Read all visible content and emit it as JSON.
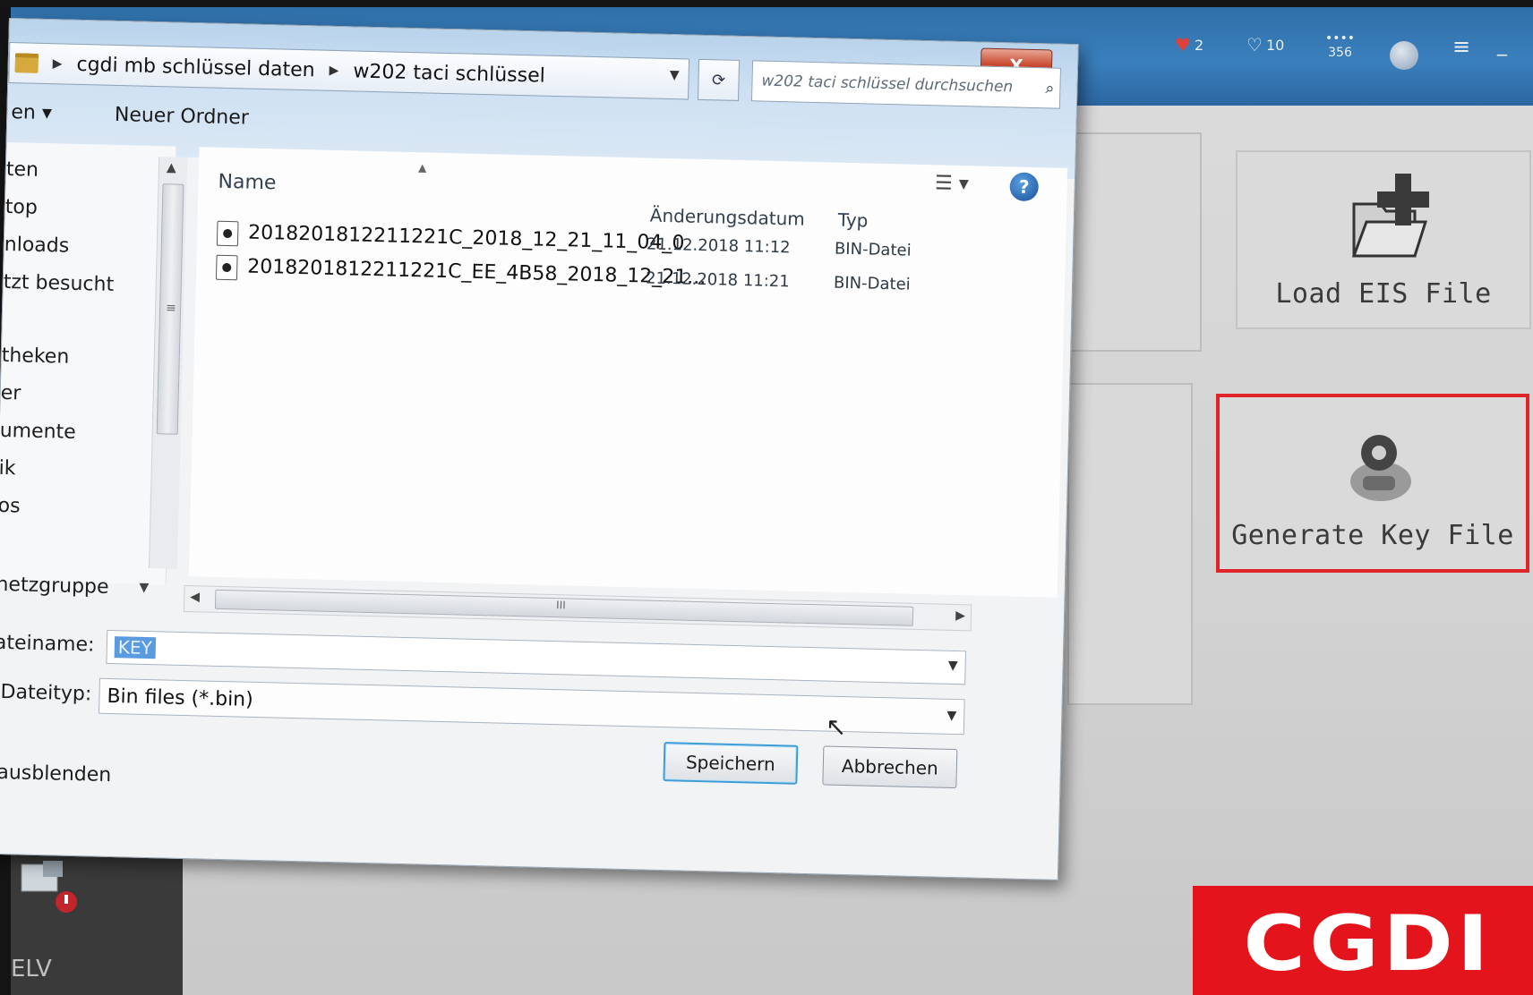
{
  "app": {
    "titlebar": {
      "heart_count": "2",
      "like_count": "10",
      "stat_top": "••••",
      "stat_value": "356",
      "menu_icon": "hamburger-icon",
      "minimize_icon": "minimize-icon"
    },
    "cards": {
      "load_eis": {
        "label": "Load EIS File",
        "icon": "folder-plus-icon"
      },
      "generate_key": {
        "label": "Generate Key File",
        "icon": "key-gear-icon",
        "highlight_color": "#e0252a"
      }
    },
    "left_strip": {
      "label": "ELV"
    },
    "brand": {
      "text": "CGDI",
      "color": "#e3141b"
    }
  },
  "dialog": {
    "close_label": "X",
    "breadcrumb": [
      "cgdi mb schlüssel daten",
      "w202 taci schlüssel"
    ],
    "search_placeholder": "w202 taci schlüssel durchsuchen",
    "toolbar": {
      "organize_label": "en ▾",
      "new_folder_label": "Neuer Ordner"
    },
    "nav_items": [
      "ten",
      "top",
      "nloads",
      "tzt besucht",
      "theken",
      "er",
      "umente",
      "ik",
      "os"
    ],
    "network_label": "netzgruppe",
    "columns": {
      "name": "Name",
      "date": "Änderungsdatum",
      "type": "Typ"
    },
    "files": [
      {
        "name": "2018201812211221C_2018_12_21_11_04_0",
        "date": "21.12.2018 11:12",
        "type": "BIN-Datei"
      },
      {
        "name": "2018201812211221C_EE_4B58_2018_12_21...",
        "date": "21.12.2018 11:21",
        "type": "BIN-Datei"
      }
    ],
    "filename_label": "ateiname:",
    "filename_value": "KEY",
    "filetype_label": "Dateityp:",
    "filetype_value": "Bin files (*.bin)",
    "save_label": "Speichern",
    "cancel_label": "Abbrechen",
    "hide_folders_label": "ausblenden"
  }
}
